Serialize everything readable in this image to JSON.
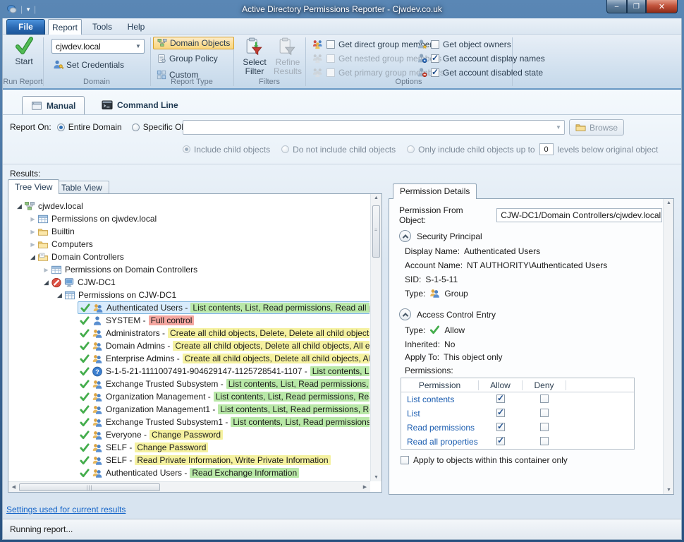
{
  "window": {
    "title": "Active Directory Permissions Reporter - Cjwdev.co.uk",
    "controls": {
      "minimize": "–",
      "maximize": "❐",
      "close": "✕"
    }
  },
  "ribbon": {
    "tabs": {
      "file": "File",
      "report": "Report",
      "tools": "Tools",
      "help": "Help",
      "active": "Report"
    },
    "run_report": {
      "group_label": "Run Report",
      "start_label": "Start"
    },
    "domain": {
      "group_label": "Domain",
      "domain_value": "cjwdev.local",
      "set_credentials_label": "Set Credentials"
    },
    "report_type": {
      "group_label": "Report Type",
      "items": [
        {
          "label": "Domain Objects",
          "selected": true,
          "icon": "domain-objects-icon"
        },
        {
          "label": "Group Policy",
          "selected": false,
          "icon": "group-policy-icon"
        },
        {
          "label": "Custom",
          "selected": false,
          "icon": "custom-icon"
        }
      ]
    },
    "filters": {
      "group_label": "Filters",
      "select_filter_label": "Select Filter",
      "refine_results_label": "Refine Results",
      "refine_results_disabled": true
    },
    "options": {
      "group_label": "Options",
      "items": [
        {
          "label": "Get direct group members",
          "checked": false,
          "disabled": false,
          "icon": "users-color-icon"
        },
        {
          "label": "Get nested group members",
          "checked": false,
          "disabled": true,
          "icon": "users-gray-icon"
        },
        {
          "label": "Get primary group members",
          "checked": false,
          "disabled": true,
          "icon": "users-gray-icon"
        },
        {
          "label": "Get object owners",
          "checked": false,
          "disabled": false,
          "icon": "person-star-icon"
        },
        {
          "label": "Get account display names",
          "checked": true,
          "disabled": false,
          "icon": "person-blue-icon"
        },
        {
          "label": "Get account disabled state",
          "checked": true,
          "disabled": false,
          "icon": "person-red-icon"
        }
      ]
    }
  },
  "view_tabs": {
    "manual": "Manual",
    "command_line": "Command Line",
    "active": "Manual"
  },
  "report_on": {
    "label": "Report On:",
    "entire_domain": "Entire Domain",
    "specific_object": "Specific Object:",
    "selected": "Entire Domain",
    "object_value": "",
    "browse_label": "Browse",
    "include_child": "Include child objects",
    "no_child": "Do not include child objects",
    "limit_child": "Only include child objects up to",
    "levels_value": "0",
    "levels_suffix": "levels below original object",
    "child_selected": "Include child objects"
  },
  "results": {
    "label": "Results:",
    "tabs": {
      "tree_view": "Tree View",
      "table_view": "Table View",
      "active": "Tree View"
    },
    "tree": {
      "items": [
        {
          "label": "cjwdev.local",
          "level": 0,
          "expander": "expanded",
          "icon": "domain-icon"
        },
        {
          "label": "Permissions on cjwdev.local",
          "level": 1,
          "expander": "collapsed",
          "icon": "report-icon"
        },
        {
          "label": "Builtin",
          "level": 1,
          "expander": "collapsed",
          "icon": "folder-icon"
        },
        {
          "label": "Computers",
          "level": 1,
          "expander": "collapsed",
          "icon": "folder-icon"
        },
        {
          "label": "Domain Controllers",
          "level": 1,
          "expander": "expanded",
          "icon": "folder-dc-icon"
        },
        {
          "label": "Permissions on Domain Controllers",
          "level": 2,
          "expander": "collapsed",
          "icon": "report-icon"
        },
        {
          "label": "CJW-DC1",
          "level": 2,
          "expander": "expanded",
          "icon": "error-icon,computer-icon"
        },
        {
          "label": "Permissions on CJW-DC1",
          "level": 3,
          "expander": "expanded",
          "icon": "report-icon"
        },
        {
          "label": "Authenticated Users -",
          "suffix": "List contents, List, Read permissions, Read all properties",
          "highlight": "green",
          "selected": true,
          "level": 4,
          "icon": "allow-check-icon,group-icon"
        },
        {
          "label": "SYSTEM -",
          "suffix": "Full control",
          "highlight": "red",
          "level": 4,
          "icon": "allow-check-icon,person-icon"
        },
        {
          "label": "Administrators -",
          "suffix": "Create all child objects, Delete, Delete all child objects, All exte",
          "highlight": "yellow",
          "level": 4,
          "icon": "allow-check-icon,group-icon"
        },
        {
          "label": "Domain Admins -",
          "suffix": "Create all child objects, Delete all child objects, All extended",
          "highlight": "yellow",
          "level": 4,
          "icon": "allow-check-icon,group-icon"
        },
        {
          "label": "Enterprise Admins -",
          "suffix": "Create all child objects, Delete all child objects, All extende",
          "highlight": "yellow",
          "level": 4,
          "icon": "allow-check-icon,group-icon"
        },
        {
          "label": "S-1-5-21-1111007491-904629147-1125728541-1107 -",
          "suffix": "List contents, List, Read pe",
          "highlight": "green",
          "level": 4,
          "icon": "allow-check-icon,question-icon"
        },
        {
          "label": "Exchange Trusted Subsystem -",
          "suffix": "List contents, List, Read permissions, Read all pr",
          "highlight": "green",
          "level": 4,
          "icon": "allow-check-icon,group-icon"
        },
        {
          "label": "Organization Management -",
          "suffix": "List contents, List, Read permissions, Read all prop",
          "highlight": "green",
          "level": 4,
          "icon": "allow-check-icon,group-icon"
        },
        {
          "label": "Organization Management1 -",
          "suffix": "List contents, List, Read permissions, Read all pro",
          "highlight": "green",
          "level": 4,
          "icon": "allow-check-icon,group-icon"
        },
        {
          "label": "Exchange Trusted Subsystem1 -",
          "suffix": "List contents, List, Read permissions, Read all p",
          "highlight": "green",
          "level": 4,
          "icon": "allow-check-icon,group-icon"
        },
        {
          "label": "Everyone -",
          "suffix": "Change Password",
          "highlight": "yellow",
          "level": 4,
          "icon": "allow-check-icon,group-icon"
        },
        {
          "label": "SELF -",
          "suffix": "Change Password",
          "highlight": "yellow",
          "level": 4,
          "icon": "allow-check-icon,group-icon"
        },
        {
          "label": "SELF -",
          "suffix": "Read Private Information, Write Private Information",
          "highlight": "yellow",
          "level": 4,
          "icon": "allow-check-icon,group-icon"
        },
        {
          "label": "Authenticated Users -",
          "suffix": "Read Exchange Information",
          "highlight": "green",
          "level": 4,
          "icon": "allow-check-icon,group-icon"
        }
      ]
    }
  },
  "details": {
    "tab": "Permission Details",
    "from_label": "Permission From Object:",
    "from_value": "CJW-DC1/Domain Controllers/cjwdev.local",
    "security_principal": {
      "title": "Security Principal",
      "display_name_label": "Display Name:",
      "display_name": "Authenticated Users",
      "account_name_label": "Account Name:",
      "account_name": "NT AUTHORITY\\Authenticated Users",
      "sid_label": "SID:",
      "sid": "S-1-5-11",
      "type_label": "Type:",
      "type": "Group"
    },
    "ace": {
      "title": "Access Control Entry",
      "type_label": "Type:",
      "type_value": "Allow",
      "inherited_label": "Inherited:",
      "inherited_value": "No",
      "apply_label": "Apply To:",
      "apply_value": "This object only",
      "permissions_label": "Permissions:",
      "table": {
        "headers": [
          "Permission",
          "Allow",
          "Deny"
        ],
        "rows": [
          {
            "name": "List contents",
            "allow": true,
            "deny": false
          },
          {
            "name": "List",
            "allow": true,
            "deny": false
          },
          {
            "name": "Read permissions",
            "allow": true,
            "deny": false
          },
          {
            "name": "Read all properties",
            "allow": true,
            "deny": false
          }
        ]
      },
      "container_checkbox_label": "Apply to objects within this container only",
      "container_checkbox_checked": false
    }
  },
  "footer": {
    "link": "Settings used for current results",
    "status": "Running report..."
  },
  "colors": {
    "titlebar": "#2a5381",
    "selection_border": "#7ab2dd",
    "selection_bg": "#d9ecfc",
    "highlight_green": "#b9e8a8",
    "highlight_yellow": "#f5f1a0",
    "highlight_red": "#f4a6a0",
    "ribbon_selected_bg": "#fbdf9d",
    "ribbon_selected_border": "#d5a02a",
    "link": "#1464c8",
    "allow_check": "#1f4e8c",
    "start_check": "#3da53f"
  }
}
